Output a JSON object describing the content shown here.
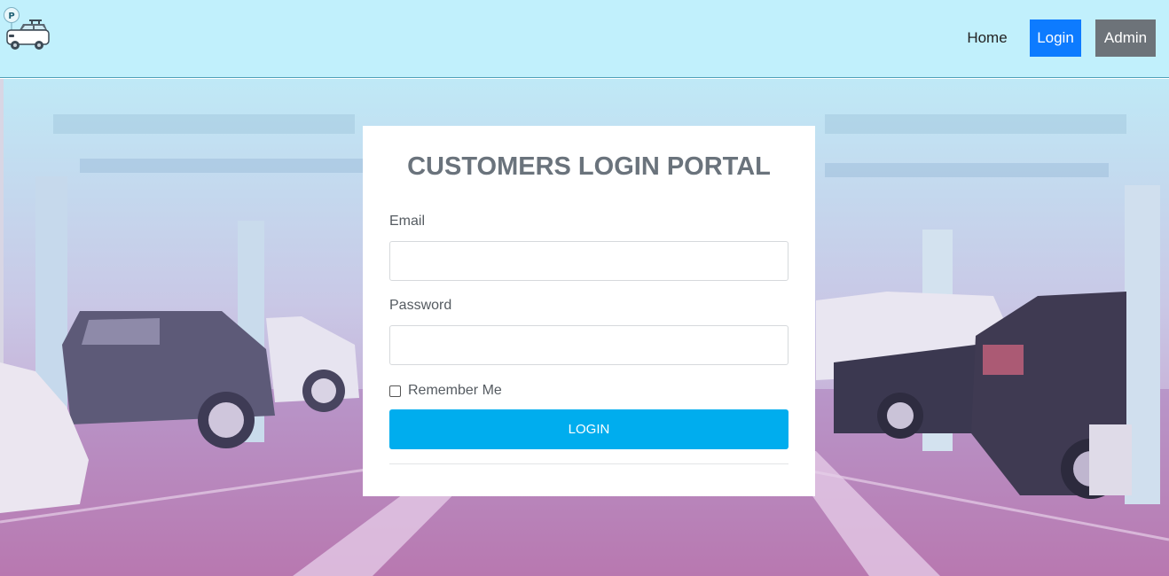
{
  "nav": {
    "home_label": "Home",
    "login_label": "Login",
    "admin_label": "Admin"
  },
  "logo": {
    "badge_text": "P",
    "icon": "parking-car-icon"
  },
  "login_card": {
    "title": "CUSTOMERS LOGIN PORTAL",
    "email_label": "Email",
    "email_value": "",
    "password_label": "Password",
    "password_value": "",
    "remember_label": "Remember Me",
    "remember_checked": false,
    "submit_label": "LOGIN"
  },
  "colors": {
    "header_bg": "#c1f0fc",
    "login_nav_bg": "#0d7bff",
    "admin_nav_bg": "#6d7379",
    "submit_bg": "#00adee",
    "title_color": "#6a737c"
  }
}
